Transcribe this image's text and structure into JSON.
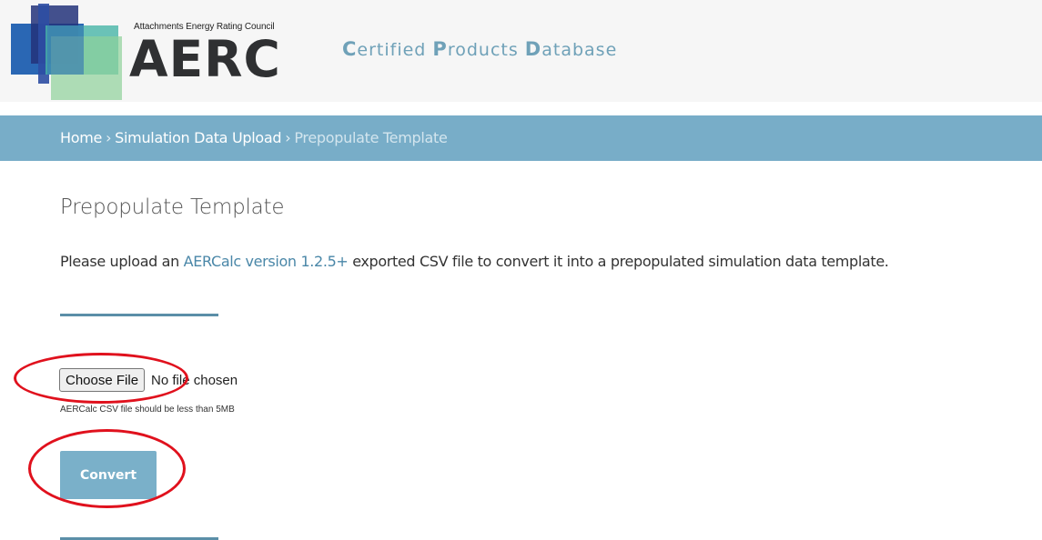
{
  "header": {
    "logo_tagline": "Attachments Energy Rating Council",
    "logo_word": "AERC",
    "site_title": [
      {
        "cap": "C",
        "rest": "ertified "
      },
      {
        "cap": "P",
        "rest": "roducts "
      },
      {
        "cap": "D",
        "rest": "atabase"
      }
    ],
    "logo_colors": {
      "blue": "#1f5fb0",
      "navy": "#23327a",
      "teal": "#47b5a8",
      "green": "#8ed19a"
    }
  },
  "breadcrumb": {
    "home": "Home",
    "sep": "›",
    "upload": "Simulation Data Upload",
    "current": "Prepopulate Template"
  },
  "page": {
    "title": "Prepopulate Template",
    "intro_before": "Please upload an ",
    "intro_link": "AERCalc version 1.2.5+",
    "intro_after": " exported CSV file to convert it into a prepopulated simulation data template."
  },
  "form": {
    "choose_label": "Choose File",
    "no_file_text": "No file chosen",
    "hint": "AERCalc CSV file should be less than 5MB",
    "convert_label": "Convert"
  },
  "colors": {
    "accent": "#78adc8",
    "link": "#4a87a8",
    "annotation": "#e0111d"
  }
}
